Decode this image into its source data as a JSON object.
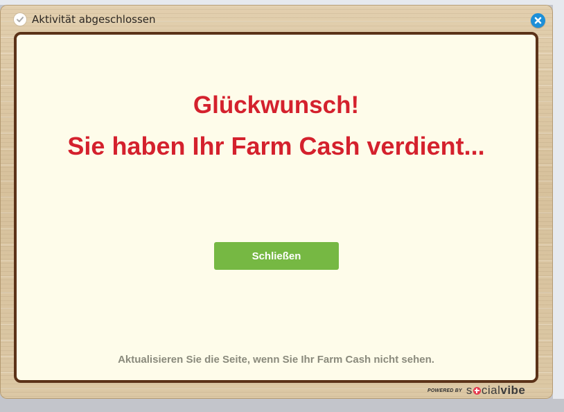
{
  "dialog": {
    "title": "Aktivität abgeschlossen",
    "title_icon": "check-circle-icon",
    "close_icon": "close-icon"
  },
  "content": {
    "headline_1": "Glückwunsch!",
    "headline_2": "Sie haben Ihr Farm Cash verdient...",
    "button_label": "Schließen",
    "hint": "Aktualisieren Sie die Seite, wenn Sie Ihr Farm Cash nicht sehen."
  },
  "footer": {
    "powered_by": "POWERED BY",
    "logo_part_1": "s",
    "logo_part_2": "cial",
    "logo_part_3": "vibe"
  },
  "colors": {
    "headline": "#d4212d",
    "button": "#76b843",
    "panel_border": "#5b3218",
    "close_button": "#1d8fd8"
  }
}
